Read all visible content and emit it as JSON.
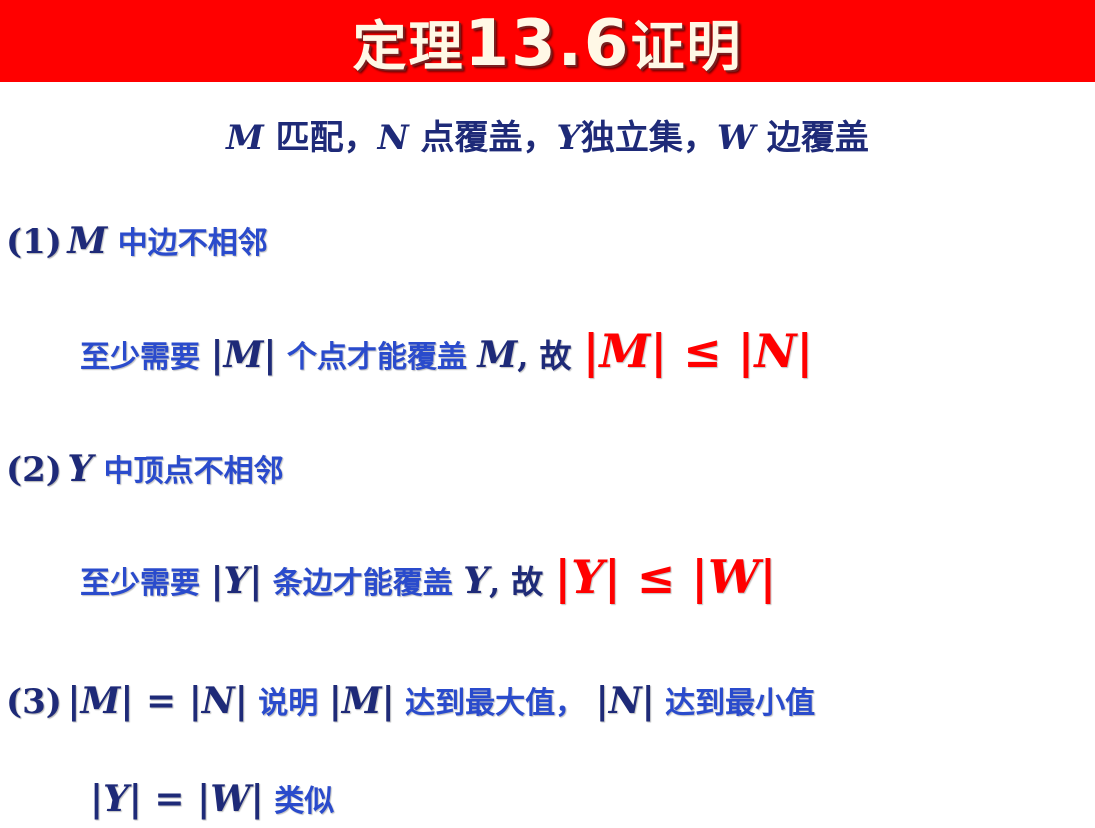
{
  "title": {
    "prefix": "定理",
    "number": "13.6",
    "suffix": "证明"
  },
  "subtitle": {
    "M": "M",
    "t1": " 匹配，",
    "N": "N",
    "t2": " 点覆盖，",
    "Y": "Y",
    "t3": "独立集，",
    "W": "W",
    "t4": " 边覆盖"
  },
  "items": [
    {
      "label": "(1)",
      "var": "M",
      "text": " 中边不相邻",
      "detail": {
        "pre": "至少需要 ",
        "card": "|M|",
        "mid": " 个点才能覆盖 ",
        "var": "M",
        "gu": ", 故 ",
        "result": "|M| ≤ |N|"
      }
    },
    {
      "label": "(2)",
      "var": "Y",
      "text": " 中顶点不相邻",
      "detail": {
        "pre": "至少需要 ",
        "card": "|Y|",
        "mid": " 条边才能覆盖 ",
        "var": "Y",
        "gu": ", 故 ",
        "result": "|Y| ≤ |W|"
      }
    },
    {
      "label": "(3)",
      "eq": "|M| = |N|",
      "t1": " 说明 ",
      "m": "|M|",
      "t2": " 达到最大值， ",
      "n": "|N|",
      "t3": " 达到最小值",
      "detail": {
        "eq": "|Y| = |W|",
        "text": " 类似"
      }
    }
  ]
}
